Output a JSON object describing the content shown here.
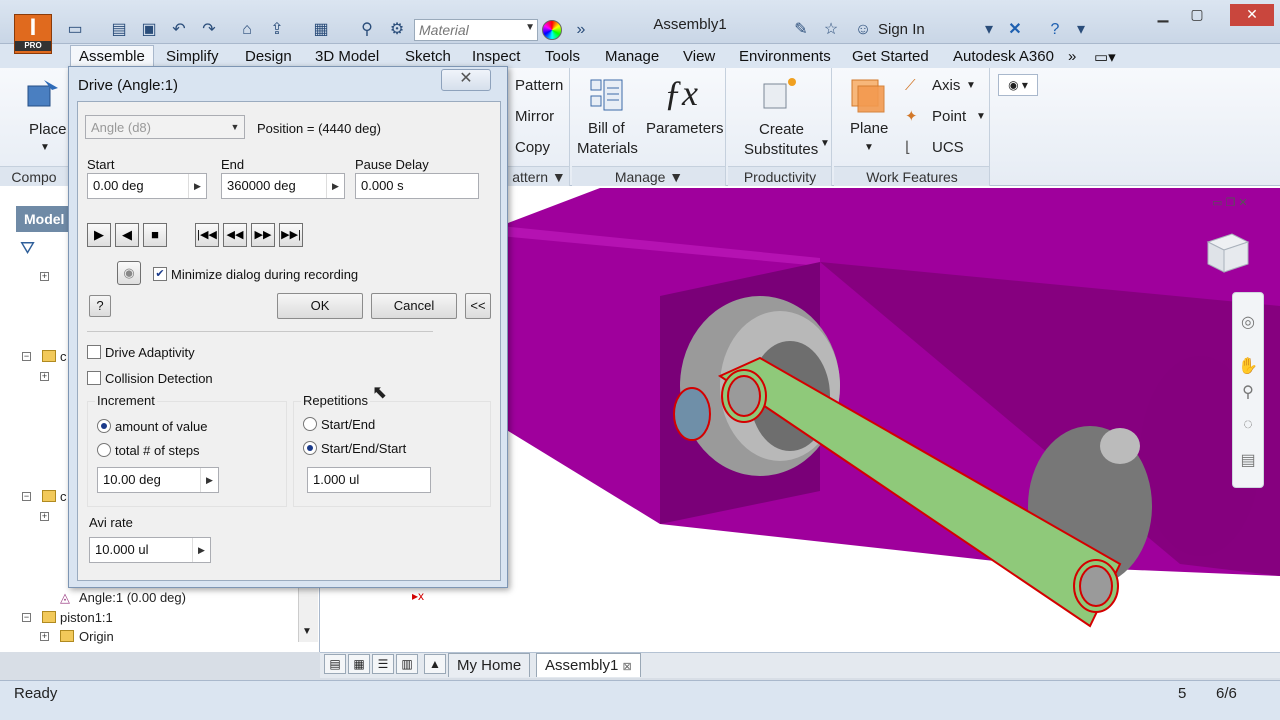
{
  "app": {
    "logo_letter": "I",
    "logo_sub": "PRO",
    "window_title": "Assembly1",
    "material_placeholder": "Material",
    "sign_in": "Sign In"
  },
  "menu": {
    "tabs": [
      "Assemble",
      "Simplify",
      "Design",
      "3D Model",
      "Sketch",
      "Inspect",
      "Tools",
      "Manage",
      "View",
      "Environments",
      "Get Started",
      "Autodesk A360"
    ]
  },
  "ribbon": {
    "place": "Place",
    "component_panel": "Compo",
    "pattern": "Pattern",
    "mirror": "Mirror",
    "copy": "Copy",
    "pattern_panel": "attern",
    "bill_of_materials_1": "Bill of",
    "bill_of_materials_2": "Materials",
    "parameters": "Parameters",
    "manage_panel": "Manage",
    "create_substitutes_1": "Create",
    "create_substitutes_2": "Substitutes",
    "productivity_panel": "Productivity",
    "plane": "Plane",
    "axis": "Axis",
    "point": "Point",
    "ucs": "UCS",
    "work_features_panel": "Work Features"
  },
  "browser": {
    "header": "Model",
    "items": [
      "Angle:1 (0.00 deg)",
      "piston1:1",
      "Origin"
    ],
    "partial_labels": [
      "c",
      "c"
    ]
  },
  "dialog": {
    "title": "Drive (Angle:1)",
    "constraint_select": "Angle (d8)",
    "position": "Position = (4440 deg)",
    "start_label": "Start",
    "start_value": "0.00 deg",
    "end_label": "End",
    "end_value": "360000 deg",
    "pause_label": "Pause Delay",
    "pause_value": "0.000 s",
    "minimize_label": "Minimize dialog during recording",
    "ok": "OK",
    "cancel": "Cancel",
    "less": "<<",
    "drive_adaptivity": "Drive Adaptivity",
    "collision_detection": "Collision Detection",
    "increment_label": "Increment",
    "amount_of_value": "amount of value",
    "total_steps": "total # of steps",
    "increment_value": "10.00 deg",
    "repetitions_label": "Repetitions",
    "start_end": "Start/End",
    "start_end_start": "Start/End/Start",
    "repetitions_value": "1.000 ul",
    "avi_rate_label": "Avi rate",
    "avi_rate_value": "10.000 ul"
  },
  "doc_tabs": {
    "home": "My Home",
    "assembly": "Assembly1"
  },
  "status": {
    "ready": "Ready",
    "count": "5",
    "pages": "6/6"
  },
  "colors": {
    "block": "#a1009e",
    "link": "#8fc97a",
    "accent": "#e06a1e"
  }
}
